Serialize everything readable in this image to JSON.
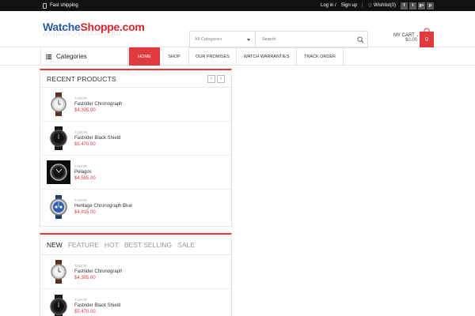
{
  "topbar": {
    "shipping": "Fast shipping",
    "login": "Log in /",
    "signup": "Sign up",
    "wishlist": "Wishlist(0)",
    "social": [
      "f",
      "t",
      "g+",
      "p"
    ]
  },
  "header": {
    "logo_main": "Watche",
    "logo_accent": "Shoppe.com",
    "search_category": "All Categories",
    "search_placeholder": "Search",
    "cart_label": "MY CART",
    "cart_total": "$0.00",
    "cart_count": "0"
  },
  "nav": {
    "categories": "Categories",
    "items": [
      "HOME",
      "SHOP",
      "OUR PROMISES",
      "WATCH WARRANTIES",
      "TRACK ORDER"
    ]
  },
  "recent": {
    "title": "RECENT PRODUCTS",
    "products": [
      {
        "brand": "TUDOR",
        "name": "Fastrider Chronograph",
        "price": "$4,305.00",
        "image": "watch-brown-strap"
      },
      {
        "brand": "TUDOR",
        "name": "Fastrider Black Shield",
        "price": "$5,470.00",
        "image": "watch-black"
      },
      {
        "brand": "TUDOR",
        "name": "Pelagos",
        "price": "$4,585.00",
        "image": "watch-steel-dark"
      },
      {
        "brand": "TUDOR",
        "name": "Heritage Chronograph Blue",
        "price": "$4,915.00",
        "image": "watch-blue"
      }
    ]
  },
  "featured": {
    "tabs": [
      "NEW",
      "FEATURE",
      "HOT",
      "BEST SELLING",
      "SALE"
    ],
    "products": [
      {
        "brand": "TUDOR",
        "name": "Fastrider Chronograph",
        "price": "$4,305.00",
        "image": "watch-brown-strap"
      },
      {
        "brand": "TUDOR",
        "name": "Fastrider Black Shield",
        "price": "$5,470.00",
        "image": "watch-black"
      }
    ]
  },
  "colors": {
    "accent": "#e03a3e",
    "topbar": "#111111",
    "logo_blue": "#2b5aa3"
  }
}
